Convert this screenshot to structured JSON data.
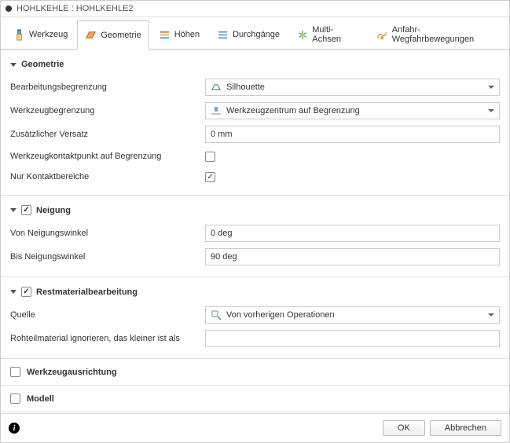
{
  "title": "HOHLKEHLE : HOHLKEHLE2",
  "tabs": {
    "werkzeug": "Werkzeug",
    "geometrie": "Geometrie",
    "hoehen": "Höhen",
    "durchgaenge": "Durchgänge",
    "multi_achsen": "Multi-Achsen",
    "anfahr": "Anfahr-Wegfahrbewegungen"
  },
  "sections": {
    "geometrie": {
      "title": "Geometrie",
      "fields": {
        "bearbeitungsbegrenzung": {
          "label": "Bearbeitungsbegrenzung",
          "value": "Silhouette"
        },
        "werkzeugbegrenzung": {
          "label": "Werkzeugbegrenzung",
          "value": "Werkzeugzentrum auf Begrenzung"
        },
        "zusaetzlicher_versatz": {
          "label": "Zusätzlicher Versatz",
          "value": "0 mm"
        },
        "werkzeugkontaktpunkt": {
          "label": "Werkzeugkontaktpunkt auf Begrenzung",
          "checked": false
        },
        "nur_kontaktbereiche": {
          "label": "Nur Kontaktbereiche",
          "checked": true
        }
      }
    },
    "neigung": {
      "title": "Neigung",
      "enabled": true,
      "fields": {
        "von": {
          "label": "Von Neigungswinkel",
          "value": "0 deg"
        },
        "bis": {
          "label": "Bis Neigungswinkel",
          "value": "90 deg"
        }
      }
    },
    "restmaterial": {
      "title": "Restmaterialbearbeitung",
      "enabled": true,
      "fields": {
        "quelle": {
          "label": "Quelle",
          "value": "Von vorherigen Operationen"
        },
        "rohteil": {
          "label": "Rohteilmaterial ignorieren, das kleiner ist als",
          "value": ""
        }
      }
    },
    "werkzeugausrichtung": {
      "title": "Werkzeugausrichtung",
      "enabled": false
    },
    "modell": {
      "title": "Modell",
      "enabled": false
    }
  },
  "footer": {
    "ok": "OK",
    "cancel": "Abbrechen"
  }
}
